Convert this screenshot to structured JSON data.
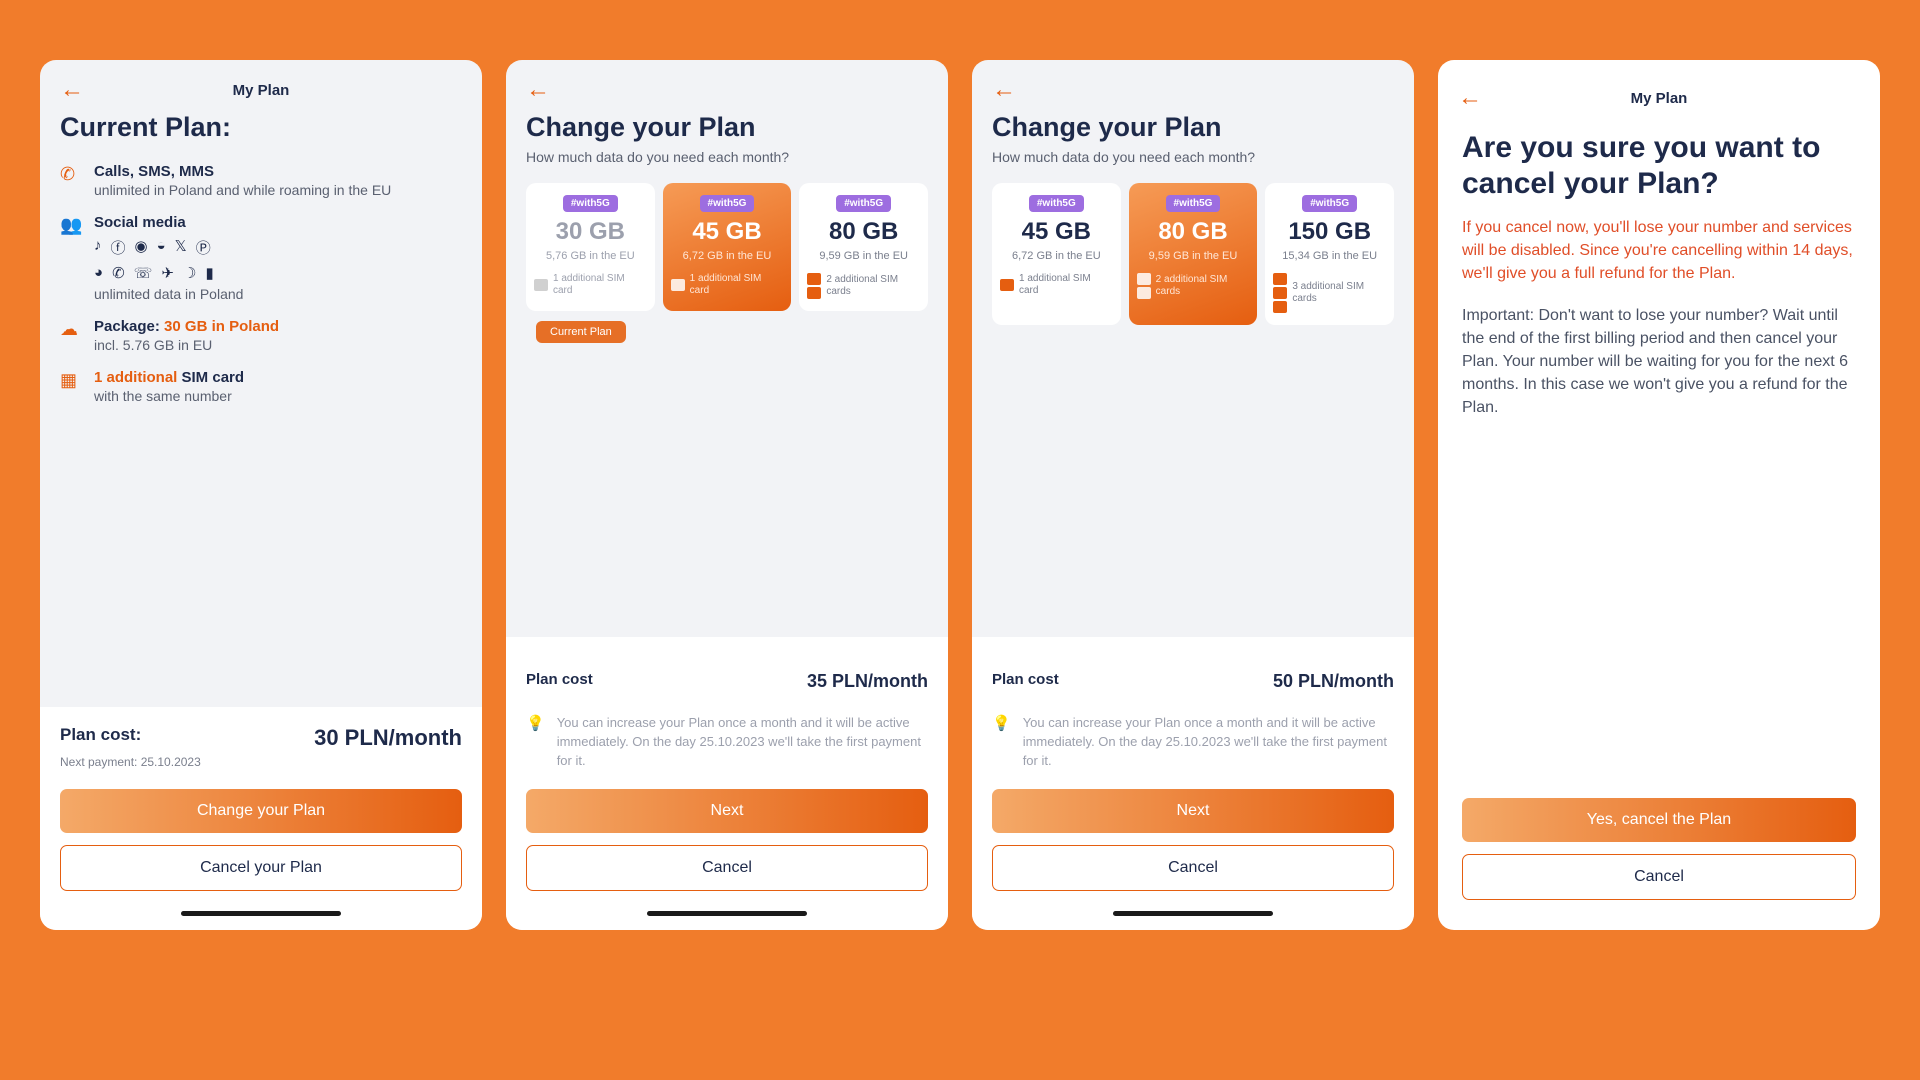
{
  "screen1": {
    "title": "My Plan",
    "heading": "Current Plan:",
    "feat_calls_title": "Calls, SMS, MMS",
    "feat_calls_desc": "unlimited in Poland and while roaming in the EU",
    "feat_social_title": "Social media",
    "feat_social_desc": "unlimited data in Poland",
    "feat_pkg_prefix": "Package: ",
    "feat_pkg_highlight": "30 GB in Poland",
    "feat_pkg_desc": "incl. 5.76 GB in EU",
    "feat_sim_highlight": "1 additional",
    "feat_sim_rest": " SIM card",
    "feat_sim_desc": "with the same number",
    "cost_label": "Plan cost:",
    "cost_value": "30 PLN/month",
    "next_payment": "Next payment: 25.10.2023",
    "btn_change": "Change your Plan",
    "btn_cancel": "Cancel your Plan"
  },
  "screen2": {
    "heading": "Change your Plan",
    "subtitle": "How much data do you need each month?",
    "badge": "#with5G",
    "plans": [
      {
        "gb": "30 GB",
        "eu": "5,76 GB in the EU",
        "sim": "1 additional SIM card",
        "sim_count": 1
      },
      {
        "gb": "45 GB",
        "eu": "6,72 GB in the EU",
        "sim": "1 additional SIM card",
        "sim_count": 1
      },
      {
        "gb": "80 GB",
        "eu": "9,59 GB in the EU",
        "sim": "2 additional SIM cards",
        "sim_count": 2
      }
    ],
    "current_chip": "Current Plan",
    "cost_label": "Plan cost",
    "cost_value": "35 PLN/month",
    "tip": "You can increase your Plan once a month and it will be active immediately. On the day 25.10.2023 we'll take the first payment for it.",
    "btn_next": "Next",
    "btn_cancel": "Cancel"
  },
  "screen3": {
    "heading": "Change your Plan",
    "subtitle": "How much data do you need each month?",
    "badge": "#with5G",
    "plans": [
      {
        "gb": "45 GB",
        "eu": "6,72 GB in the EU",
        "sim": "1 additional SIM card",
        "sim_count": 1
      },
      {
        "gb": "80 GB",
        "eu": "9,59 GB in the EU",
        "sim": "2 additional SIM cards",
        "sim_count": 2
      },
      {
        "gb": "150 GB",
        "eu": "15,34 GB in the EU",
        "sim": "3 additional SIM cards",
        "sim_count": 3
      }
    ],
    "cost_label": "Plan cost",
    "cost_value": "50 PLN/month",
    "tip": "You can increase your Plan once a month and it will be active immediately. On the day 25.10.2023 we'll take the first payment for it.",
    "btn_next": "Next",
    "btn_cancel": "Cancel"
  },
  "screen4": {
    "title": "My Plan",
    "heading": "Are you sure you want to cancel your Plan?",
    "warning": "If you cancel now, you'll lose your number and services will be disabled. Since you're cancelling within 14 days, we'll give you a full refund for the Plan.",
    "info": "Important: Don't want to lose your number? Wait until the end of the first billing period and then cancel your Plan. Your number will be waiting for you for the next 6 months. In this case we won't give you a refund for the Plan.",
    "btn_yes": "Yes, cancel the Plan",
    "btn_cancel": "Cancel"
  }
}
